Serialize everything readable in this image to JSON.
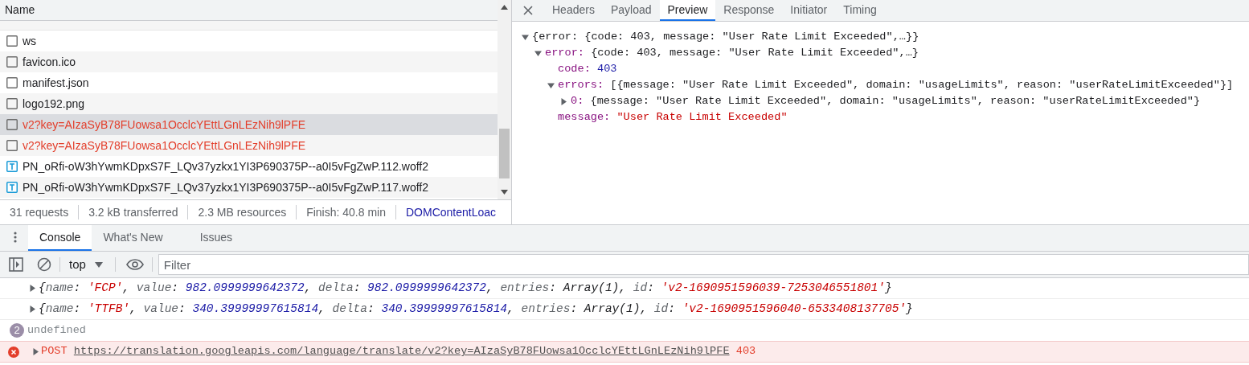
{
  "network": {
    "column_header": "Name",
    "requests": [
      {
        "name": "ws",
        "kind": "document",
        "failed": false,
        "selected": false
      },
      {
        "name": "favicon.ico",
        "kind": "document",
        "failed": false,
        "selected": false
      },
      {
        "name": "manifest.json",
        "kind": "document",
        "failed": false,
        "selected": false
      },
      {
        "name": "logo192.png",
        "kind": "document",
        "failed": false,
        "selected": false
      },
      {
        "name": "v2?key=AIzaSyB78FUowsa1OcclcYEttLGnLEzNih9lPFE",
        "kind": "document",
        "failed": true,
        "selected": true
      },
      {
        "name": "v2?key=AIzaSyB78FUowsa1OcclcYEttLGnLEzNih9lPFE",
        "kind": "document",
        "failed": true,
        "selected": false
      },
      {
        "name": "PN_oRfi-oW3hYwmKDpxS7F_LQv37yzkx1YI3P690375P--a0I5vFgZwP.112.woff2",
        "kind": "font",
        "failed": false,
        "selected": false
      },
      {
        "name": "PN_oRfi-oW3hYwmKDpxS7F_LQv37yzkx1YI3P690375P--a0I5vFgZwP.117.woff2",
        "kind": "font",
        "failed": false,
        "selected": false
      }
    ],
    "status": [
      "31 requests",
      "3.2 kB transferred",
      "2.3 MB resources",
      "Finish: 40.8 min"
    ],
    "status_link": "DOMContentLoac"
  },
  "details": {
    "tabs": [
      {
        "label": "Headers",
        "selected": false
      },
      {
        "label": "Payload",
        "selected": false
      },
      {
        "label": "Preview",
        "selected": true
      },
      {
        "label": "Response",
        "selected": false
      },
      {
        "label": "Initiator",
        "selected": false
      },
      {
        "label": "Timing",
        "selected": false
      }
    ],
    "preview": [
      {
        "summary": "{error: {code: 403, message: \"User Rate Limit Exceeded\",…}}",
        "expanded": true,
        "children": [
          {
            "key": "error:",
            "summary": "{code: 403, message: \"User Rate Limit Exceeded\",…}",
            "expanded": true,
            "children": [
              {
                "key": "code:",
                "value": "403",
                "kind": "number"
              },
              {
                "key": "errors:",
                "summary": "[{message: \"User Rate Limit Exceeded\", domain: \"usageLimits\", reason: \"userRateLimitExceeded\"}]",
                "expanded": true,
                "children": [
                  {
                    "key": "0:",
                    "summary": "{message: \"User Rate Limit Exceeded\", domain: \"usageLimits\", reason: \"userRateLimitExceeded\"}",
                    "expanded": false
                  }
                ]
              },
              {
                "key": "message:",
                "value": "\"User Rate Limit Exceeded\"",
                "kind": "string"
              }
            ]
          }
        ]
      }
    ]
  },
  "drawer": {
    "tabs": [
      {
        "label": "Console",
        "selected": true
      },
      {
        "label": "What's New",
        "selected": false
      },
      {
        "label": "Issues",
        "selected": false
      }
    ],
    "context": "top",
    "filter_placeholder": "Filter",
    "messages": [
      {
        "kind": "object",
        "tokens": [
          {
            "t": "{",
            "kind": "punct"
          },
          {
            "t": "name",
            "kind": "key"
          },
          {
            "t": ": ",
            "kind": "punct"
          },
          {
            "t": "'FCP'",
            "kind": "string"
          },
          {
            "t": ", ",
            "kind": "punct"
          },
          {
            "t": "value",
            "kind": "key"
          },
          {
            "t": ": ",
            "kind": "punct"
          },
          {
            "t": "982.0999999642372",
            "kind": "number"
          },
          {
            "t": ", ",
            "kind": "punct"
          },
          {
            "t": "delta",
            "kind": "key"
          },
          {
            "t": ": ",
            "kind": "punct"
          },
          {
            "t": "982.0999999642372",
            "kind": "number"
          },
          {
            "t": ", ",
            "kind": "punct"
          },
          {
            "t": "entries",
            "kind": "key"
          },
          {
            "t": ": Array(1), ",
            "kind": "punct"
          },
          {
            "t": "id",
            "kind": "key"
          },
          {
            "t": ": ",
            "kind": "punct"
          },
          {
            "t": "'v2-1690951596039-7253046551801'",
            "kind": "string"
          },
          {
            "t": "}",
            "kind": "punct"
          }
        ]
      },
      {
        "kind": "object",
        "tokens": [
          {
            "t": "{",
            "kind": "punct"
          },
          {
            "t": "name",
            "kind": "key"
          },
          {
            "t": ": ",
            "kind": "punct"
          },
          {
            "t": "'TTFB'",
            "kind": "string"
          },
          {
            "t": ", ",
            "kind": "punct"
          },
          {
            "t": "value",
            "kind": "key"
          },
          {
            "t": ": ",
            "kind": "punct"
          },
          {
            "t": "340.39999997615814",
            "kind": "number"
          },
          {
            "t": ", ",
            "kind": "punct"
          },
          {
            "t": "delta",
            "kind": "key"
          },
          {
            "t": ": ",
            "kind": "punct"
          },
          {
            "t": "340.39999997615814",
            "kind": "number"
          },
          {
            "t": ", ",
            "kind": "punct"
          },
          {
            "t": "entries",
            "kind": "key"
          },
          {
            "t": ": Array(1), ",
            "kind": "punct"
          },
          {
            "t": "id",
            "kind": "key"
          },
          {
            "t": ": ",
            "kind": "punct"
          },
          {
            "t": "'v2-1690951596040-6533408137705'",
            "kind": "string"
          },
          {
            "t": "}",
            "kind": "punct"
          }
        ]
      },
      {
        "kind": "result",
        "count": "2",
        "text": "undefined"
      },
      {
        "kind": "error",
        "method": "POST",
        "url": "https://translation.googleapis.com/language/translate/v2?key=AIzaSyB78FUowsa1OcclcYEttLGnLEzNih9lPFE",
        "status": "403"
      }
    ]
  }
}
